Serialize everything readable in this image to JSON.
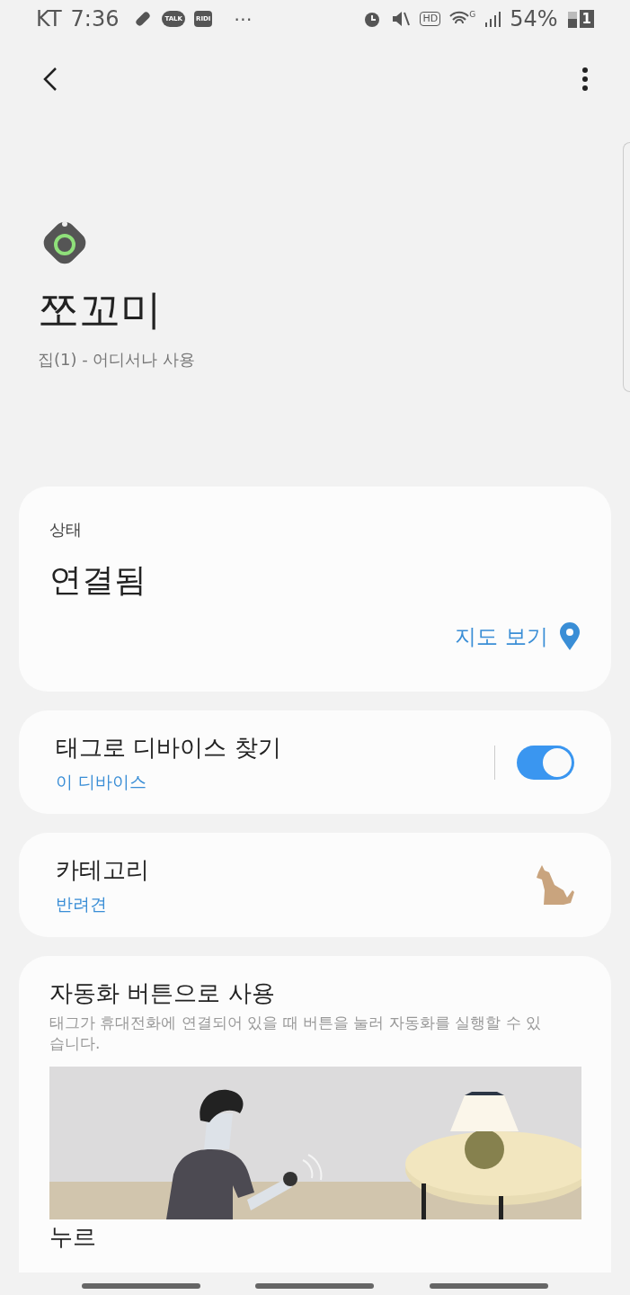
{
  "status_bar": {
    "carrier": "KT",
    "time": "7:36",
    "app_badges": [
      "TALK",
      "RIDI"
    ],
    "more": "⋯",
    "hd": "HD",
    "network": "G",
    "battery": "54%",
    "sim": "1"
  },
  "device": {
    "name": "쪼꼬미",
    "subtitle": "집(1) - 어디서나 사용"
  },
  "status_card": {
    "label": "상태",
    "value": "연결됨",
    "map_link": "지도 보기"
  },
  "find_card": {
    "title": "태그로 디바이스 찾기",
    "subtitle": "이 디바이스",
    "on": true
  },
  "category_card": {
    "title": "카테고리",
    "subtitle": "반려견"
  },
  "automation_card": {
    "title": "자동화 버튼으로 사용",
    "description": "태그가 휴대전화에 연결되어 있을 때 버튼을 눌러 자동화를 실행할 수 있습니다.",
    "next_heading": "누르"
  }
}
